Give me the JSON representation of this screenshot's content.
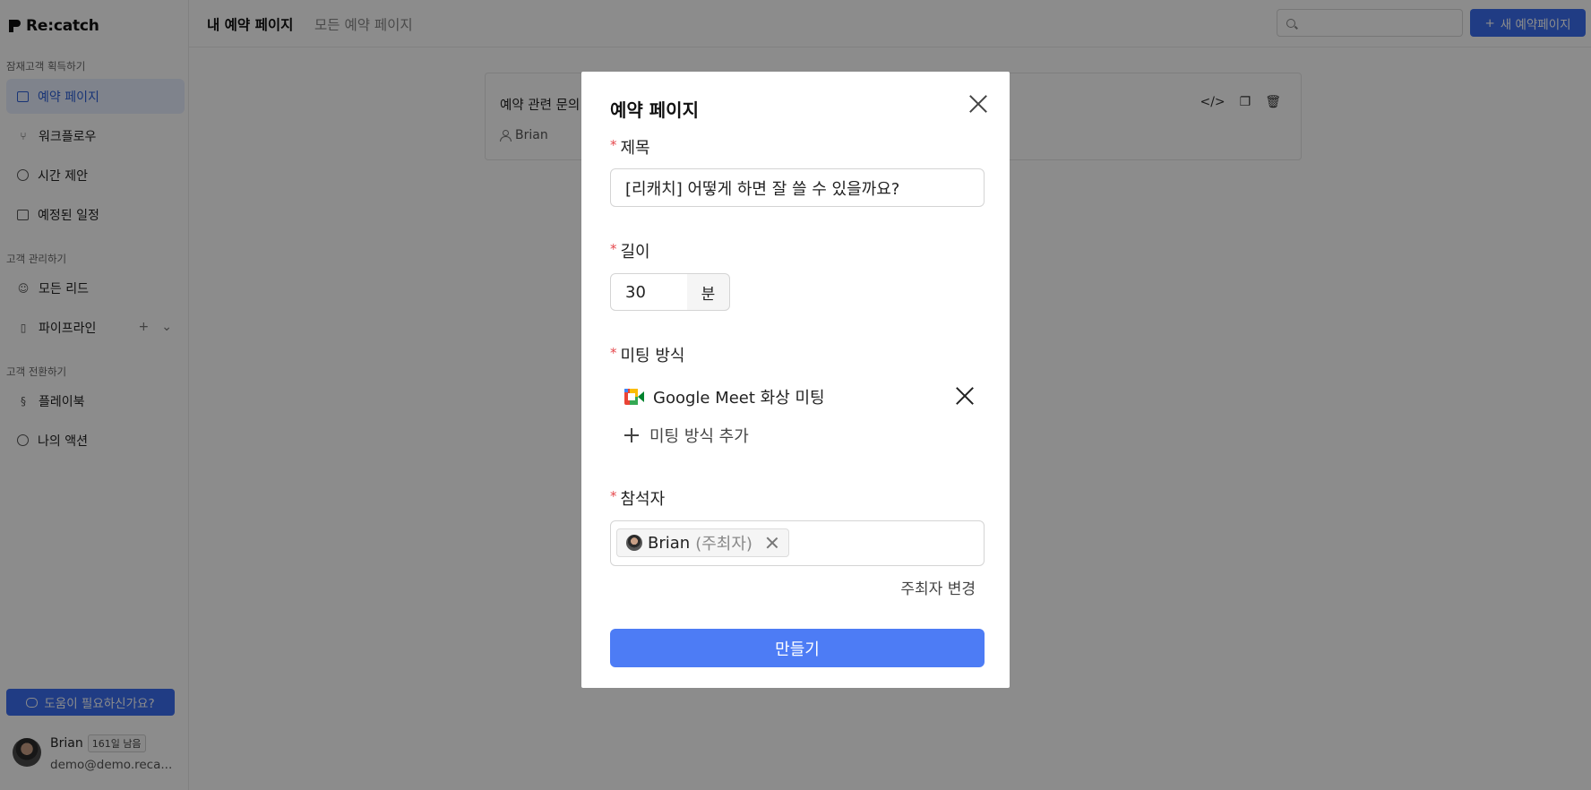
{
  "app": {
    "brand": "Re:catch",
    "sidebar": {
      "section_acquire": "잠재고객 획득하기",
      "section_manage": "고객 관리하기",
      "section_convert": "고객 전환하기",
      "items": [
        {
          "label": "예약 페이지",
          "icon": "calendar-icon",
          "active": true
        },
        {
          "label": "워크플로우",
          "icon": "workflow-icon",
          "active": false
        },
        {
          "label": "시간 제안",
          "icon": "clock-icon",
          "active": false
        },
        {
          "label": "예정된 일정",
          "icon": "calendar-check-icon",
          "active": false
        },
        {
          "label": "모든 리드",
          "icon": "users-icon",
          "active": false
        },
        {
          "label": "파이프라인",
          "icon": "pipeline-icon",
          "active": false
        },
        {
          "label": "플레이북",
          "icon": "playbook-icon",
          "active": false
        },
        {
          "label": "나의 액션",
          "icon": "check-circle-icon",
          "active": false
        }
      ],
      "help_button": "도움이 필요하신가요?",
      "profile": {
        "name": "Brian",
        "trial_badge": "161일 남음",
        "email": "demo@demo.reca..."
      }
    },
    "topbar": {
      "tab_mine": "내 예약 페이지",
      "tab_all": "모든 예약 페이지",
      "new_button": "새 예약페이지"
    },
    "card": {
      "title": "예약 관련 문의",
      "owner": "Brian"
    }
  },
  "modal": {
    "title": "예약 페이지",
    "title_field": {
      "label": "제목",
      "value": "[리캐치] 어떻게 하면 잘 쓸 수 있을까요?"
    },
    "duration_field": {
      "label": "길이",
      "value": "30",
      "unit": "분"
    },
    "meeting_field": {
      "label": "미팅 방식",
      "selected": "Google Meet 화상 미팅",
      "add_label": "미팅 방식 추가"
    },
    "attendees_field": {
      "label": "참석자",
      "attendee_name": "Brian",
      "attendee_role": "(주최자)",
      "change_host": "주최자 변경"
    },
    "submit_label": "만들기",
    "required_mark": "*"
  },
  "colors": {
    "primary": "#4d7cf5",
    "active_nav_bg": "#e8efff",
    "required": "#e5484d",
    "overlay": "rgba(0,0,0,0.45)"
  }
}
